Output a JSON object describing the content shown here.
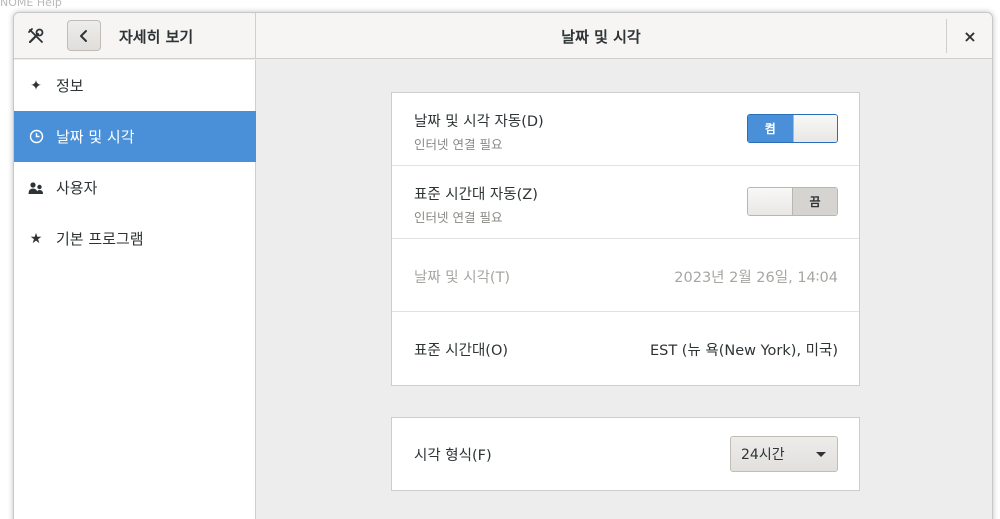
{
  "background": {
    "text": "NOME Help"
  },
  "header": {
    "left_title": "자세히 보기",
    "title": "날짜 및 시각",
    "close_glyph": "×"
  },
  "sidebar": {
    "items": [
      {
        "label": "정보",
        "icon": "sparkle-icon",
        "glyph": "✦"
      },
      {
        "label": "날짜 및 시각",
        "icon": "clock-icon",
        "glyph": "",
        "active": true
      },
      {
        "label": "사용자",
        "icon": "users-icon",
        "glyph": ""
      },
      {
        "label": "기본 프로그램",
        "icon": "star-icon",
        "glyph": "★"
      }
    ]
  },
  "main": {
    "auto_datetime": {
      "title": "날짜 및 시각 자동(D)",
      "subtitle": "인터넷 연결 필요",
      "switch_label": "켬",
      "state": "on"
    },
    "auto_timezone": {
      "title": "표준 시간대 자동(Z)",
      "subtitle": "인터넷 연결 필요",
      "switch_label": "끔",
      "state": "off"
    },
    "datetime": {
      "title": "날짜 및 시각(T)",
      "value": "2023년 2월 26일, 14∶04"
    },
    "timezone": {
      "title": "표준 시간대(O)",
      "value": "EST (뉴 욕(New York), 미국)"
    },
    "time_format": {
      "title": "시각 형식(F)",
      "selected": "24시간"
    }
  },
  "colors": {
    "accent": "#4a90d9",
    "window_bg": "#ededed",
    "sidebar_bg": "#ffffff"
  }
}
